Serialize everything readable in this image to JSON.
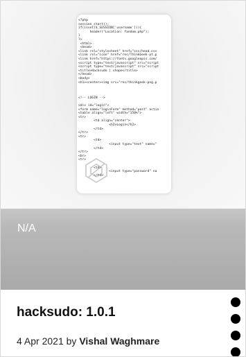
{
  "card": {
    "fallback_label": "N/A",
    "preview_code": "<?php\nsession_start();\nif(isset($_SESSION['username'])){\n      header(\"Location: fandom.php\");\n}\n?>\n <html>\n <head>\n<link rel=\"stylesheet\" href=\"css/head.css\n<link rel=\"icon\" href=\"res/ThinkGeek-pt.p\n<link href=\"https://fonts.googleapis.com/\n<script type=\"text/javascript\" src=\"script\n<script type=\"text/javascript\" src=\"script\n<title>Hacksudo | shope</title>\n</head>\n<body>\n<h1><center><img src=\"res/thinkgeek-png.p\n\n\n\n<!-- LOGIN -->\n\n<div id=\"login\">\n<form name=\"loginForm\" method=\"post\" actio\n<table align=\"left\" width=\"150%\">\n<tr>\n        <td align=\"center\">\n                <h2>Login</h2>\n        </td>\n</tr>\n<tr>\n        <td>\n                <input type=\"text\" name=\"\n        </td>\n</tr>\n<br>\n<tr>\n\n        <td>\n                <input type=\"password\" na\n        </td>",
    "title": "hacksudo: 1.0.1",
    "date": "4 Apr 2021",
    "by": "by",
    "author": "Vishal Waghmare",
    "menu_icon": "vertical-dots-icon"
  }
}
